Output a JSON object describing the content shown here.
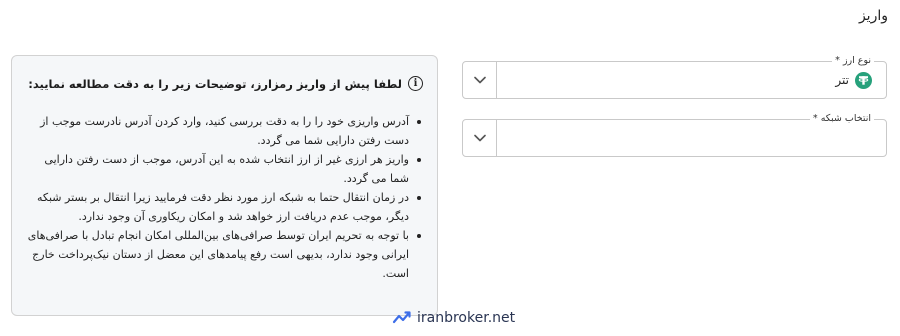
{
  "page": {
    "title": "واریز"
  },
  "currency_field": {
    "label": "نوع ارز *",
    "value": "تتر",
    "icon": "tether-icon",
    "icon_color": "#26a17b"
  },
  "network_field": {
    "label": "انتخاب شبکه *",
    "value": ""
  },
  "notice": {
    "heading": "لطفا پیش از واریز رمزارز، توضیحات زیر را به دقت مطالعه نمایید:",
    "items": [
      "آدرس واریزی خود را را به دقت بررسی کنید، وارد کردن آدرس نادرست موجب از دست رفتن دارایی شما می گردد.",
      "واریز هر ارزی غیر از ارز انتخاب شده به این آدرس، موجب از دست رفتن دارایی شما می گردد.",
      "در زمان انتقال حتما به شبکه ارز مورد نظر دقت فرمایید زیرا انتقال بر بستر شبکه دیگر، موجب عدم دریافت ارز خواهد شد و امکان ریکاوری آن وجود ندارد.",
      "با توجه به تحریم ایران توسط صرافی‌های بین‌المللی امکان انجام تبادل با صرافی‌های ایرانی وجود ندارد، بدیهی است رفع پیامدهای این معضل از دستان نیک‌پرداخت خارج است."
    ]
  },
  "watermark": {
    "text": "iranbroker.net"
  }
}
